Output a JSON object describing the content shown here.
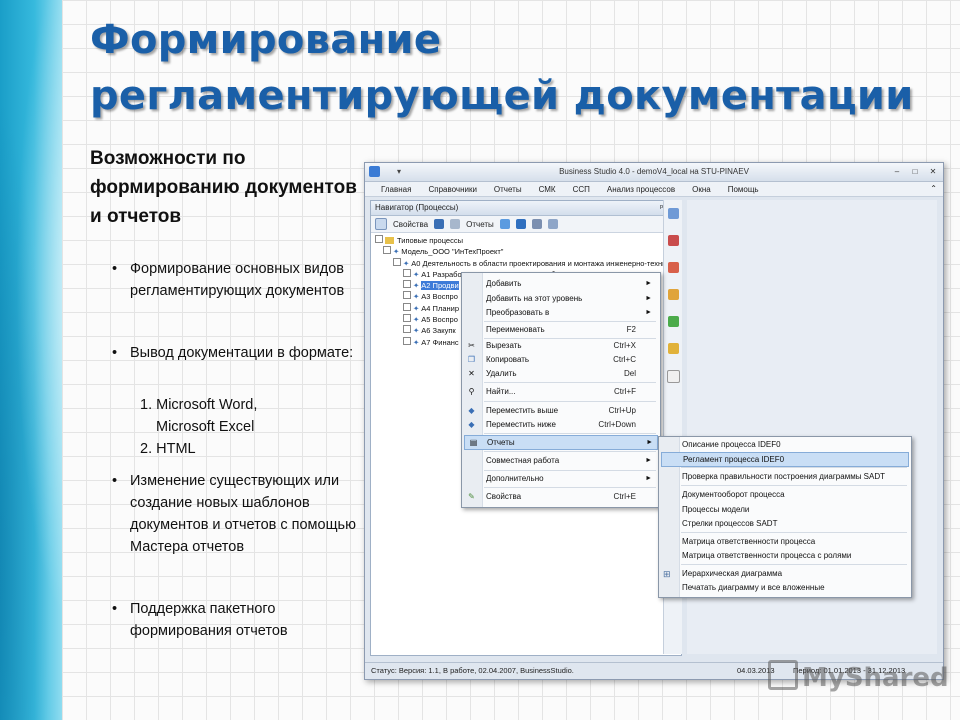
{
  "slide": {
    "title_line1": "Формирование",
    "title_line2": "регламентирующей документации",
    "subtitle": "Возможности по формированию документов и отчетов",
    "bullets": [
      "Формирование основных видов регламентирующих документов",
      "Вывод документации в формате:",
      "Изменение существующих или создание новых шаблонов документов  и отчетов с помощью Мастера отчетов",
      "Поддержка пакетного формирования отчетов"
    ],
    "formats": [
      "1. Microsoft Word,",
      "Microsoft Excel",
      "2. HTML"
    ],
    "watermark": "MyShared"
  },
  "app": {
    "title": "Business Studio 4.0 - demoV4_local на STU-PINAEV",
    "menu": [
      "Главная",
      "Справочники",
      "Отчеты",
      "СМК",
      "ССП",
      "Анализ процессов",
      "Окна",
      "Помощь"
    ],
    "navigator": {
      "header": "Навигатор (Процессы)",
      "toolbar_props": "Свойства",
      "toolbar_reports": "Отчеты",
      "tree": [
        "Типовые процессы",
        "Модель_ООО \"ИнТехПроект\"",
        "А0 Деятельность в области проектирования и монтажа инженерно-техни",
        "А1 Разработка стратегии и развитие бизнеса",
        "А2 Продви",
        "А3 Воспро",
        "А4 Планир",
        "А5 Воспро",
        "А6 Закупк",
        "А7 Финанс"
      ]
    },
    "status": {
      "left": "Статус: Версия: 1.1, В работе, 02.04.2007, BusinessStudio.",
      "date": "04.03.2013",
      "period": "Период: 01.01.2013 - 31.12.2013"
    },
    "context_menu": [
      {
        "label": "Добавить",
        "shortcut": "",
        "arrow": "►"
      },
      {
        "label": "Добавить на этот уровень",
        "shortcut": "",
        "arrow": "►"
      },
      {
        "label": "Преобразовать в",
        "shortcut": "",
        "arrow": "►"
      },
      {
        "label": "Переименовать",
        "shortcut": "F2",
        "arrow": ""
      },
      {
        "label": "Вырезать",
        "shortcut": "Ctrl+X",
        "arrow": ""
      },
      {
        "label": "Копировать",
        "shortcut": "Ctrl+C",
        "arrow": ""
      },
      {
        "label": "Удалить",
        "shortcut": "Del",
        "arrow": ""
      },
      {
        "label": "Найти...",
        "shortcut": "Ctrl+F",
        "arrow": ""
      },
      {
        "label": "Переместить выше",
        "shortcut": "Ctrl+Up",
        "arrow": ""
      },
      {
        "label": "Переместить ниже",
        "shortcut": "Ctrl+Down",
        "arrow": ""
      },
      {
        "label": "Отчеты",
        "shortcut": "",
        "arrow": "►"
      },
      {
        "label": "Совместная работа",
        "shortcut": "",
        "arrow": "►"
      },
      {
        "label": "Дополнительно",
        "shortcut": "",
        "arrow": "►"
      },
      {
        "label": "Свойства",
        "shortcut": "Ctrl+E",
        "arrow": ""
      }
    ],
    "reports_submenu": [
      "Описание процесса IDEF0",
      "Регламент процесса IDEF0",
      "Проверка правильности построения диаграммы SADT",
      "Документооборот процесса",
      "Процессы модели",
      "Стрелки процессов SADT",
      "Матрица ответственности процесса",
      "Матрица ответственности процесса с ролями",
      "Иерархическая диаграмма",
      "Печатать диаграмму и все вложенные"
    ]
  }
}
